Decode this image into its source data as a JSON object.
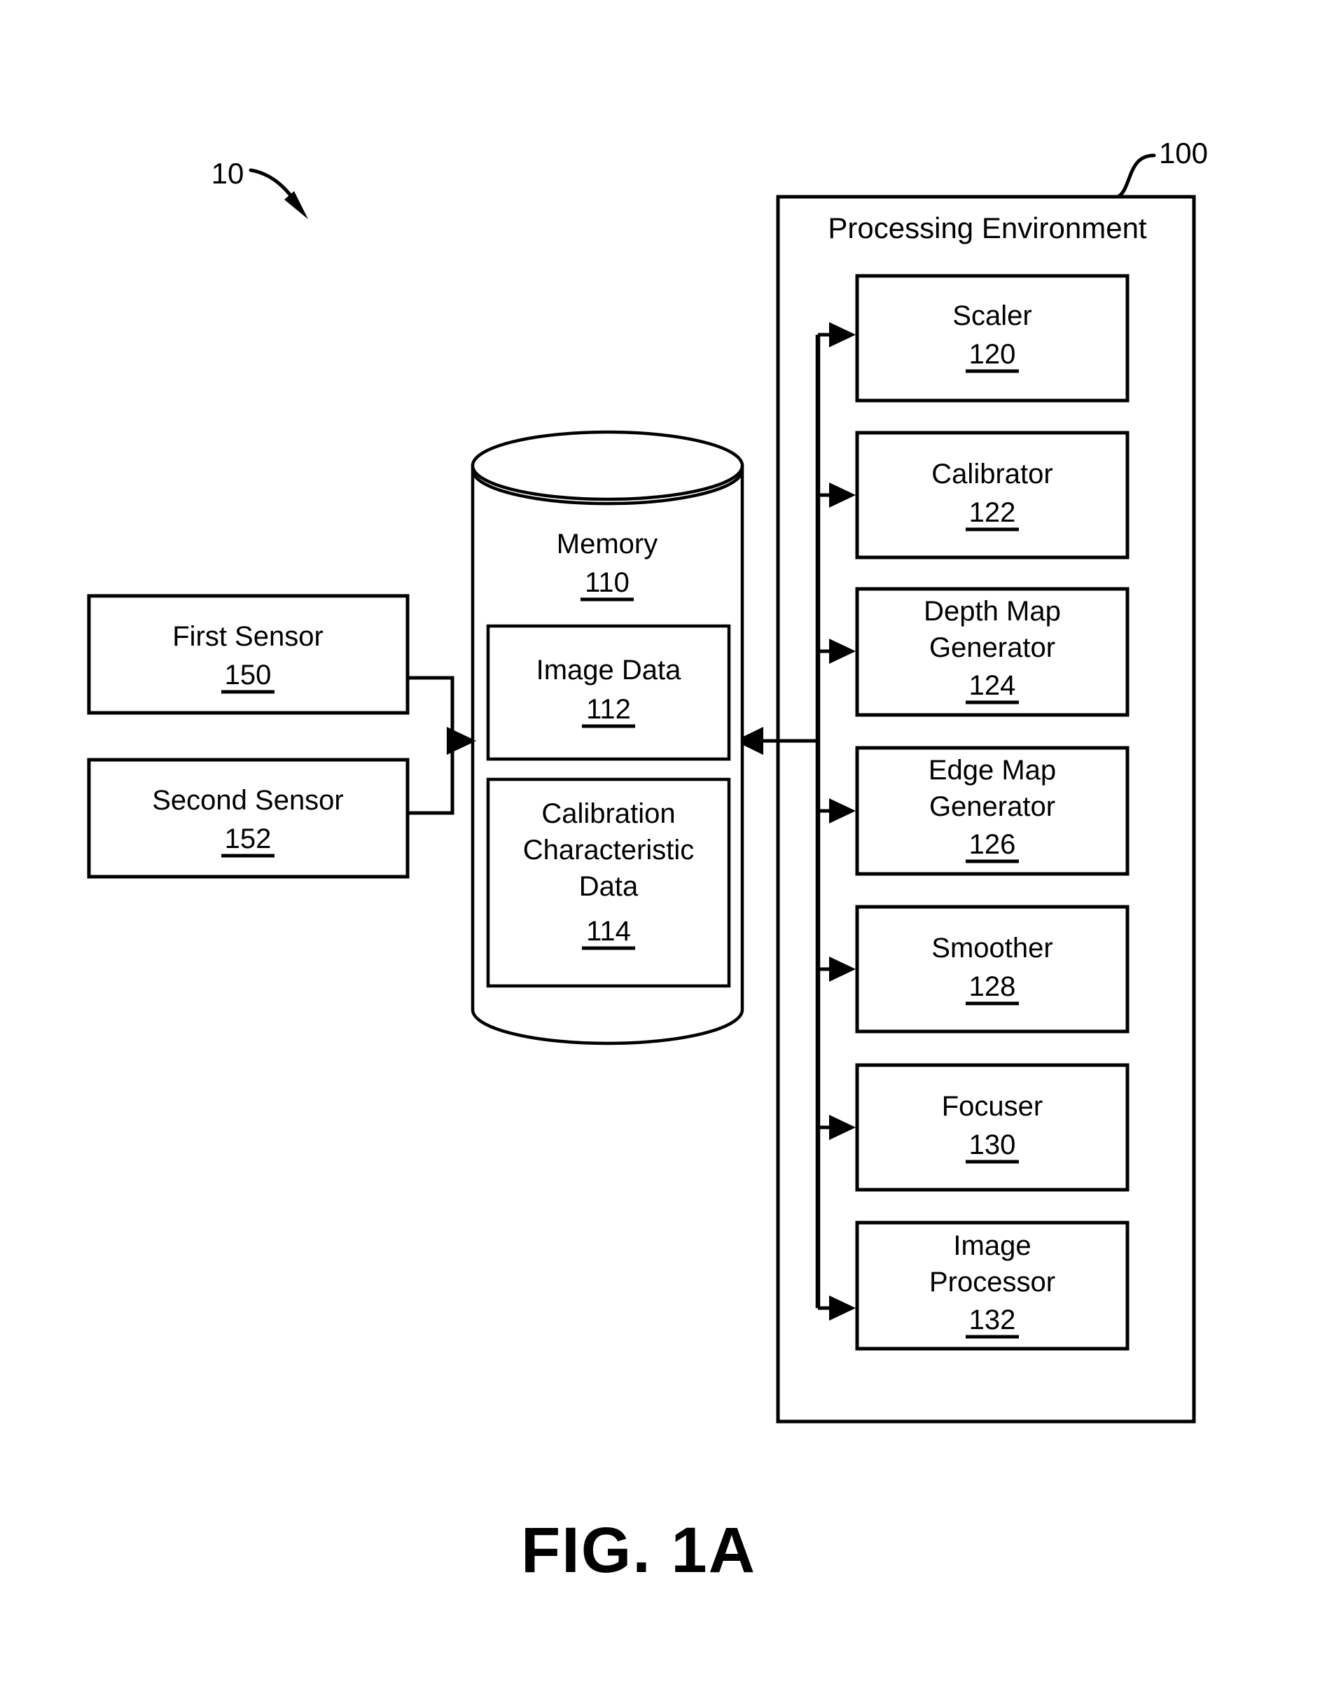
{
  "figure": {
    "caption": "FIG. 1A",
    "system_callout": "10",
    "environment_callout": "100"
  },
  "processing_environment": {
    "title": "Processing Environment",
    "ref": "100",
    "modules": [
      {
        "label": "Scaler",
        "ref": "120",
        "lines": [
          "Scaler"
        ]
      },
      {
        "label": "Calibrator",
        "ref": "122",
        "lines": [
          "Calibrator"
        ]
      },
      {
        "label": "Depth Map Generator",
        "ref": "124",
        "lines": [
          "Depth Map",
          "Generator"
        ]
      },
      {
        "label": "Edge Map Generator",
        "ref": "126",
        "lines": [
          "Edge Map",
          "Generator"
        ]
      },
      {
        "label": "Smoother",
        "ref": "128",
        "lines": [
          "Smoother"
        ]
      },
      {
        "label": "Focuser",
        "ref": "130",
        "lines": [
          "Focuser"
        ]
      },
      {
        "label": "Image Processor",
        "ref": "132",
        "lines": [
          "Image",
          "Processor"
        ]
      }
    ]
  },
  "memory": {
    "label": "Memory",
    "ref": "110",
    "stores": [
      {
        "label": "Image Data",
        "ref": "112",
        "lines": [
          "Image Data"
        ]
      },
      {
        "label": "Calibration Characteristic Data",
        "ref": "114",
        "lines": [
          "Calibration",
          "Characteristic",
          "Data"
        ]
      }
    ]
  },
  "sensors": [
    {
      "label": "First Sensor",
      "ref": "150",
      "lines": [
        "First Sensor"
      ]
    },
    {
      "label": "Second Sensor",
      "ref": "152",
      "lines": [
        "Second Sensor"
      ]
    }
  ]
}
